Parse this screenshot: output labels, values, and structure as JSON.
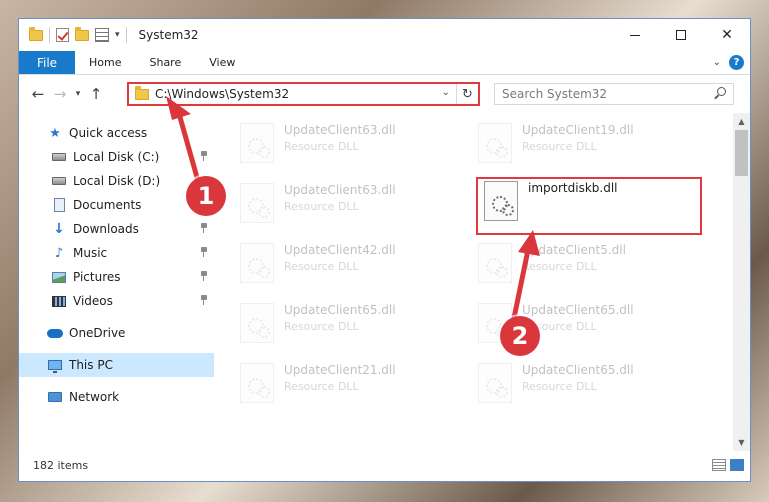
{
  "window": {
    "title": "System32",
    "controls": {
      "minimize": "minimize",
      "maximize": "maximize",
      "close": "✕"
    }
  },
  "ribbon": {
    "tabs": [
      {
        "label": "File",
        "active": true
      },
      {
        "label": "Home"
      },
      {
        "label": "Share"
      },
      {
        "label": "View"
      }
    ],
    "help": "?"
  },
  "address": {
    "path": "C:\\Windows\\System32",
    "search_placeholder": "Search System32"
  },
  "sidebar": {
    "items": [
      {
        "label": "Quick access",
        "icon": "star-icon"
      },
      {
        "label": "Local Disk (C:)",
        "icon": "drive-icon",
        "pinned": true
      },
      {
        "label": "Local Disk (D:)",
        "icon": "drive-icon"
      },
      {
        "label": "Documents",
        "icon": "documents-icon"
      },
      {
        "label": "Downloads",
        "icon": "download-icon",
        "pinned": true
      },
      {
        "label": "Music",
        "icon": "music-icon",
        "pinned": true
      },
      {
        "label": "Pictures",
        "icon": "pictures-icon",
        "pinned": true
      },
      {
        "label": "Videos",
        "icon": "videos-icon",
        "pinned": true
      },
      {
        "label": "OneDrive",
        "icon": "onedrive-icon"
      },
      {
        "label": "This PC",
        "icon": "computer-icon",
        "selected": true
      },
      {
        "label": "Network",
        "icon": "network-icon"
      }
    ]
  },
  "files": [
    {
      "name": "UpdateClient63.dll",
      "type": "Resource DLL",
      "faded": true
    },
    {
      "name": "UpdateClient19.dll",
      "type": "Resource DLL",
      "faded": true
    },
    {
      "name": "UpdateClient63.dll",
      "type": "Resource DLL",
      "faded": true
    },
    {
      "name": "importdiskb.dll",
      "type": "",
      "highlighted": true
    },
    {
      "name": "UpdateClient42.dll",
      "type": "Resource DLL",
      "faded": true
    },
    {
      "name": "UpdateClient5.dll",
      "type": "Resource DLL",
      "faded": true
    },
    {
      "name": "UpdateClient65.dll",
      "type": "Resource DLL",
      "faded": true
    },
    {
      "name": "UpdateClient65.dll",
      "type": "Resource DLL",
      "faded": true
    },
    {
      "name": "UpdateClient21.dll",
      "type": "Resource DLL",
      "faded": true
    },
    {
      "name": "UpdateClient65.dll",
      "type": "Resource DLL",
      "faded": true
    }
  ],
  "status": {
    "item_count": "182 items"
  },
  "annotations": {
    "step1": "1",
    "step2": "2"
  },
  "colors": {
    "accent": "#1979ca",
    "highlight": "#e0393e",
    "selection": "#cce8ff"
  }
}
